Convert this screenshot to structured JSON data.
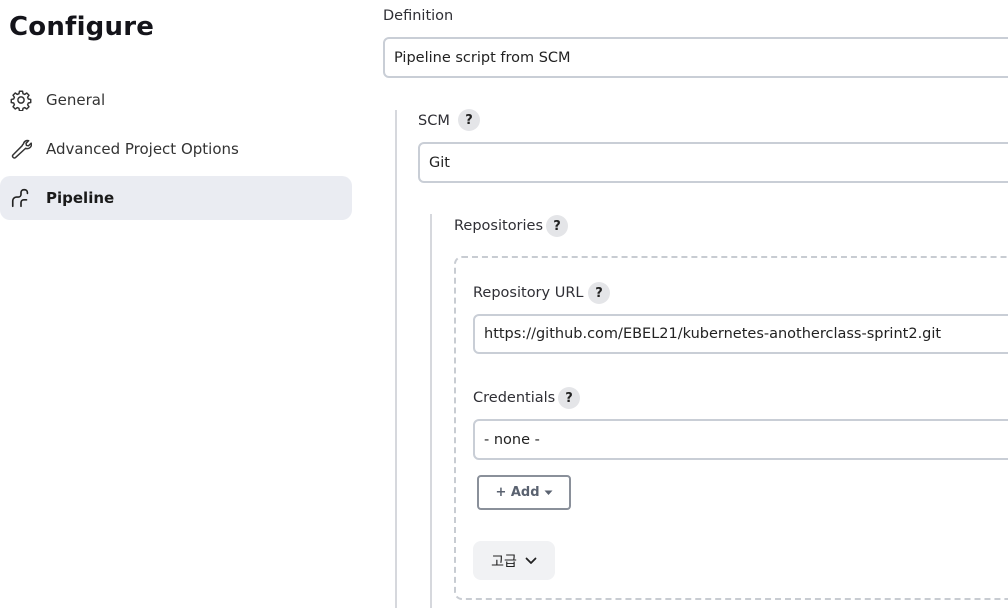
{
  "page_title": "Configure",
  "sidebar": {
    "items": [
      {
        "label": "General",
        "icon": "gear-icon"
      },
      {
        "label": "Advanced Project Options",
        "icon": "wrench-icon"
      },
      {
        "label": "Pipeline",
        "icon": "pipeline-icon",
        "active": true
      }
    ]
  },
  "definition": {
    "label": "Definition",
    "value": "Pipeline script from SCM"
  },
  "scm": {
    "label": "SCM",
    "help": "?",
    "value": "Git"
  },
  "repositories": {
    "label": "Repositories",
    "help": "?",
    "repo_url_label": "Repository URL",
    "repo_url_help": "?",
    "repo_url_value": "https://github.com/EBEL21/kubernetes-anotherclass-sprint2.git",
    "credentials_label": "Credentials",
    "credentials_help": "?",
    "credentials_value": "- none -",
    "add_label": "+ Add",
    "advanced_label": "고급"
  }
}
